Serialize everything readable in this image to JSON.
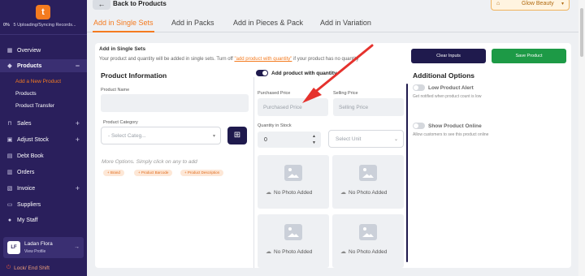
{
  "sidebar": {
    "logo_letter": "t",
    "sync_percent": "0%",
    "sync_status": "5 Uploading/Syncing Records...",
    "items": [
      {
        "label": "Overview",
        "icon": "grid-icon"
      },
      {
        "label": "Products",
        "icon": "tag-icon",
        "expanded": true
      },
      {
        "label": "Sales",
        "icon": "cart-icon"
      },
      {
        "label": "Adjust Stock",
        "icon": "box-icon"
      },
      {
        "label": "Debt Book",
        "icon": "book-icon"
      },
      {
        "label": "Orders",
        "icon": "clipboard-icon"
      },
      {
        "label": "Invoice",
        "icon": "document-icon"
      },
      {
        "label": "Suppliers",
        "icon": "truck-icon"
      },
      {
        "label": "My Staff",
        "icon": "user-icon"
      }
    ],
    "product_subitems": [
      "Add a New Product",
      "Products",
      "Product Transfer"
    ],
    "profile": {
      "initials": "LF",
      "name": "Ladan Flora",
      "link": "View Profile"
    },
    "lock_label": "Lock/ End Shift"
  },
  "topbar": {
    "back_label": "Back to Products",
    "store_name": "Glow Beauty"
  },
  "tabs": [
    "Add in Single Sets",
    "Add in Packs",
    "Add in Pieces & Pack",
    "Add in Variation"
  ],
  "form": {
    "title": "Add in Single Sets",
    "desc_before": "Your product and quantity will be added in single sets. Turn off ",
    "desc_link": "\"add product with quantity\"",
    "desc_after": " if your product has no quantity",
    "clear_button": "Clear Inputs",
    "save_button": "Save Product",
    "product_info": {
      "heading": "Product Information",
      "name_label": "Product Name",
      "category_label": "Product Category",
      "category_placeholder": "- Select Categ...",
      "more_options": "More Options. Simply click on any to add",
      "chips": [
        "+ Brand",
        "+ Product Barcode",
        "+ Product Description"
      ]
    },
    "quantity": {
      "toggle_label": "Add product with quantity",
      "purchased_label": "Purchased Price",
      "purchased_placeholder": "Purchased Price",
      "selling_label": "Selling Price",
      "selling_placeholder": "Selling Price",
      "stock_label": "Quantity in Stock",
      "stock_value": "0",
      "unit_placeholder": "Select Unit"
    },
    "photos": [
      "No Photo Added",
      "No Photo Added",
      "No Photo Added",
      "No Photo Added"
    ],
    "additional": {
      "heading": "Additional Options",
      "alert_label": "Low Product Alert",
      "alert_hint": "Get notified when product count is low",
      "online_label": "Show Product Online",
      "online_hint": "Allow customers to see this product online"
    }
  },
  "colors": {
    "sidebar_bg": "#2a1f5c",
    "accent": "#f47b20",
    "primary_button": "#1f1a4d",
    "save_button": "#1d9a46",
    "annotation_arrow": "#e5322d"
  }
}
